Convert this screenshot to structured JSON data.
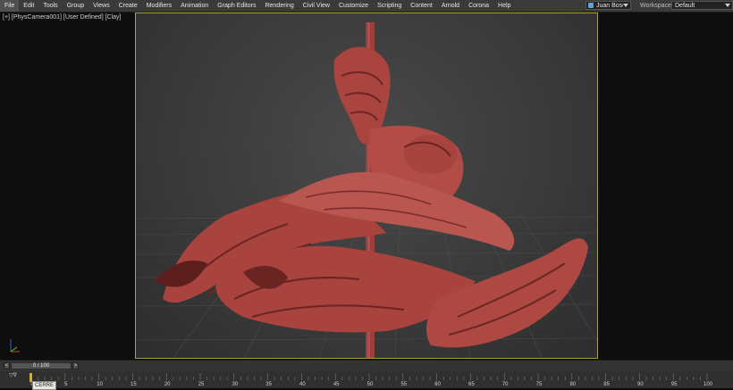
{
  "menu": [
    "File",
    "Edit",
    "Tools",
    "Group",
    "Views",
    "Create",
    "Modifiers",
    "Animation",
    "Graph Editors",
    "Rendering",
    "Civil View",
    "Customize",
    "Scripting",
    "Content",
    "Arnold",
    "Corona",
    "Help"
  ],
  "user_account": "Juan Bosco ...",
  "workspaces_label": "Workspaces:",
  "workspace_value": "Default",
  "viewport_label": "[+] [PhysCamera001] [User Defined] [Clay]",
  "time_slider": {
    "position": "0 / 100",
    "left_arrow": "<",
    "right_arrow": ">"
  },
  "timeline": {
    "ticks": [
      "0",
      "5",
      "10",
      "15",
      "20",
      "25",
      "30",
      "35",
      "40",
      "45",
      "50",
      "55",
      "60",
      "65",
      "70",
      "75",
      "80",
      "85",
      "90",
      "95",
      "100"
    ],
    "current_frame": 0,
    "key_mode_label": "▽∇",
    "tooltip": "CERRE"
  },
  "colors": {
    "frame_border": "#a5a13a",
    "clay": "#b24a46",
    "timeline_marker": "#d8b400"
  }
}
